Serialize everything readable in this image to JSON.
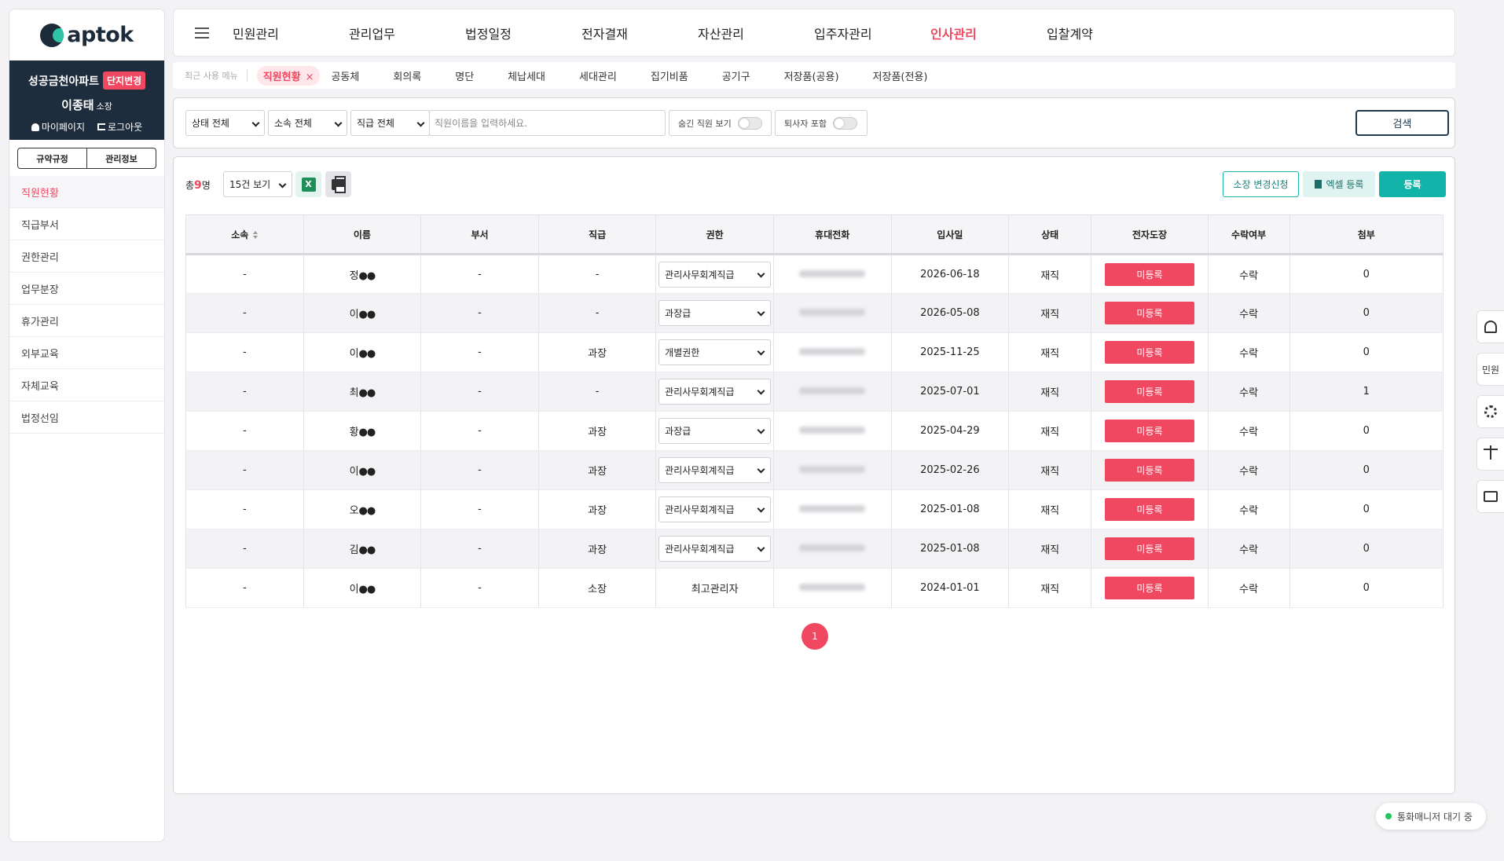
{
  "logo": {
    "text": "aptok"
  },
  "user": {
    "complex": "성공금천아파트",
    "change_label": "단지변경",
    "name": "이종태",
    "role": "소장",
    "mypage": "마이페이지",
    "logout": "로그아웃"
  },
  "side_tabs": [
    "규약규정",
    "관리정보"
  ],
  "side_menu": [
    "직원현황",
    "직급부서",
    "권한관리",
    "업무분장",
    "휴가관리",
    "외부교육",
    "자체교육",
    "법정선임"
  ],
  "nav": [
    "민원관리",
    "관리업무",
    "법정일정",
    "전자결재",
    "자산관리",
    "입주자관리",
    "인사관리",
    "입찰계약"
  ],
  "recent": {
    "label": "최근 사용 메뉴",
    "tabs": [
      "직원현황",
      "공동체",
      "회의록",
      "명단",
      "체납세대",
      "세대관리",
      "집기비품",
      "공기구",
      "저장품(공용)",
      "저장품(전용)"
    ],
    "close": "×"
  },
  "filter": {
    "status": "상태 전체",
    "affiliation": "소속 전체",
    "position": "직급 전체",
    "search_placeholder": "직원이름을 입력하세요.",
    "hidden_toggle": "숨긴 직원 보기",
    "retired_toggle": "퇴사자 포함",
    "search_button": "검색"
  },
  "toolbar": {
    "total_prefix": "총",
    "total_count": "9",
    "total_suffix": "명",
    "page_size": "15건 보기",
    "request_button": "소장 변경신청",
    "excel_register": "엑셀 등록",
    "register": "등록"
  },
  "table": {
    "headers": [
      "소속",
      "이름",
      "부서",
      "직급",
      "권한",
      "휴대전화",
      "입사일",
      "상태",
      "전자도장",
      "수락여부",
      "첨부"
    ],
    "rows": [
      {
        "aff": "-",
        "name": "정",
        "dept": "-",
        "pos": "-",
        "auth": "관리사무회계직급",
        "auth_select": true,
        "date": "2026-06-18",
        "status": "재직",
        "seal": "미등록",
        "accept": "수락",
        "attach": "0"
      },
      {
        "aff": "-",
        "name": "이",
        "dept": "-",
        "pos": "-",
        "auth": "과장급",
        "auth_select": true,
        "date": "2026-05-08",
        "status": "재직",
        "seal": "미등록",
        "accept": "수락",
        "attach": "0"
      },
      {
        "aff": "-",
        "name": "이",
        "dept": "-",
        "pos": "과장",
        "auth": "개별권한",
        "auth_select": true,
        "date": "2025-11-25",
        "status": "재직",
        "seal": "미등록",
        "accept": "수락",
        "attach": "0"
      },
      {
        "aff": "-",
        "name": "최",
        "dept": "-",
        "pos": "-",
        "auth": "관리사무회계직급",
        "auth_select": true,
        "date": "2025-07-01",
        "status": "재직",
        "seal": "미등록",
        "accept": "수락",
        "attach": "1"
      },
      {
        "aff": "-",
        "name": "황",
        "dept": "-",
        "pos": "과장",
        "auth": "과장급",
        "auth_select": true,
        "date": "2025-04-29",
        "status": "재직",
        "seal": "미등록",
        "accept": "수락",
        "attach": "0"
      },
      {
        "aff": "-",
        "name": "이",
        "dept": "-",
        "pos": "과장",
        "auth": "관리사무회계직급",
        "auth_select": true,
        "date": "2025-02-26",
        "status": "재직",
        "seal": "미등록",
        "accept": "수락",
        "attach": "0"
      },
      {
        "aff": "-",
        "name": "오",
        "dept": "-",
        "pos": "과장",
        "auth": "관리사무회계직급",
        "auth_select": true,
        "date": "2025-01-08",
        "status": "재직",
        "seal": "미등록",
        "accept": "수락",
        "attach": "0"
      },
      {
        "aff": "-",
        "name": "김",
        "dept": "-",
        "pos": "과장",
        "auth": "관리사무회계직급",
        "auth_select": true,
        "date": "2025-01-08",
        "status": "재직",
        "seal": "미등록",
        "accept": "수락",
        "attach": "0"
      },
      {
        "aff": "-",
        "name": "이",
        "dept": "-",
        "pos": "소장",
        "auth": "최고관리자",
        "auth_select": false,
        "date": "2024-01-01",
        "status": "재직",
        "seal": "미등록",
        "accept": "수락",
        "attach": "0"
      }
    ],
    "name_mask": "●●"
  },
  "pagination": {
    "current": "1"
  },
  "rail": {
    "complaint": "민원"
  },
  "call_status": "통화매니저 대기 중",
  "colors": {
    "accent": "#f04861",
    "teal": "#12b3a8",
    "navy": "#1e2d3d"
  }
}
